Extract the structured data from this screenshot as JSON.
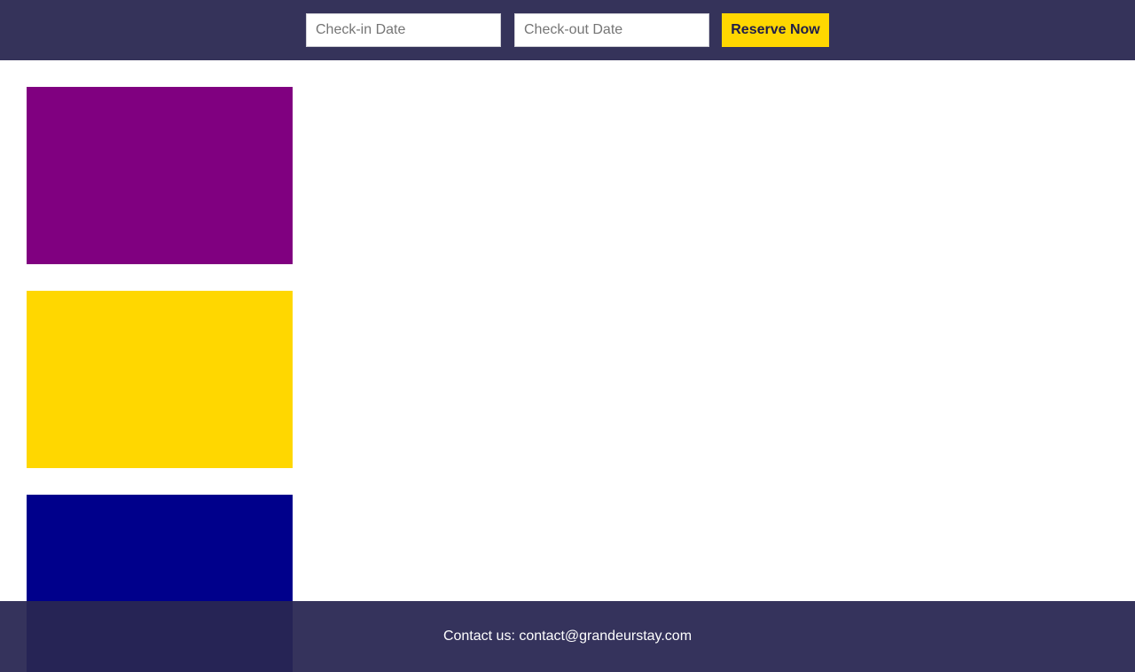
{
  "booking_bar": {
    "checkin_placeholder": "Check-in Date",
    "checkout_placeholder": "Check-out Date",
    "reserve_label": "Reserve Now",
    "bar_color": "#35335a",
    "button_color": "#ffd700"
  },
  "swatches": [
    {
      "name": "purple",
      "color": "#800080"
    },
    {
      "name": "gold",
      "color": "#ffd700"
    },
    {
      "name": "navy",
      "color": "#00008b"
    }
  ],
  "footer": {
    "contact_text": "Contact us: contact@grandeurstay.com"
  }
}
